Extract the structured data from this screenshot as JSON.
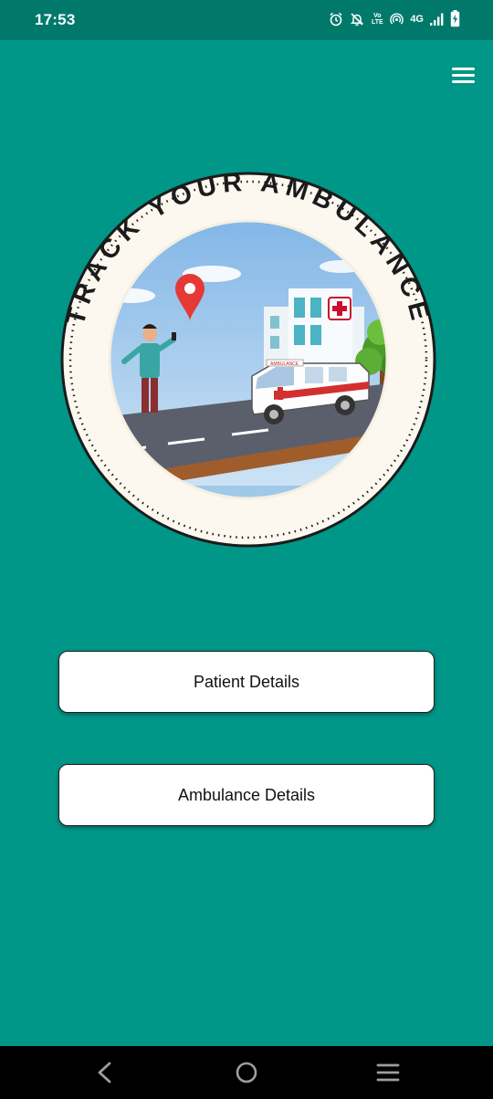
{
  "status_bar": {
    "time": "17:53",
    "network_type": "4G",
    "volte_label": "Vo LTE",
    "icons": [
      "alarm-icon",
      "notifications-off-icon",
      "volte-icon",
      "hotspot-icon",
      "signal-icon",
      "battery-charging-icon"
    ]
  },
  "header": {
    "menu_icon": "hamburger-menu-icon"
  },
  "logo": {
    "ring_text": "TRACK YOUR AMBULANCE",
    "vehicle_text": "AMBULANCE"
  },
  "main": {
    "patient_button_label": "Patient Details",
    "ambulance_button_label": "Ambulance Details"
  },
  "navigation": {
    "icons": [
      "back-icon",
      "home-icon",
      "recents-icon"
    ]
  },
  "colors": {
    "background": "#009688",
    "status_bar": "#00796b",
    "button_background": "#ffffff",
    "navigation_bar": "#000000"
  }
}
